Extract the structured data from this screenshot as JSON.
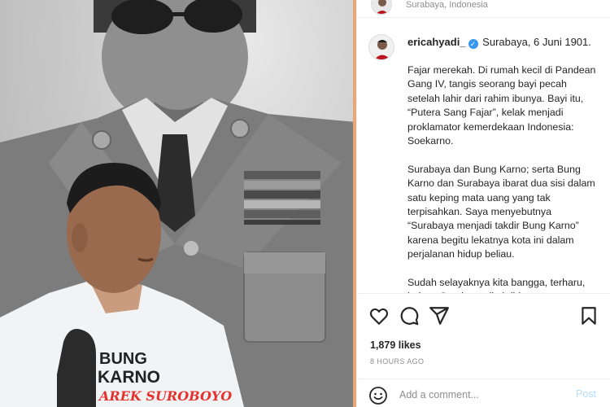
{
  "post": {
    "location": "Surabaya, Indonesia",
    "username": "ericahyadi_",
    "verified": true,
    "caption_first_line": "Surabaya, 6 Juni 1901.",
    "paragraphs": [
      "Fajar merekah. Di rumah kecil di Pandean Gang IV, tangis seorang bayi pecah setelah lahir dari rahim ibunya. Bayi itu, “Putera Sang Fajar”, kelak menjadi proklamator kemerdekaan Indonesia: Soekarno.",
      "Surabaya dan Bung Karno; serta Bung Karno dan Surabaya ibarat dua sisi dalam satu keping mata uang yang tak terpisahkan. Saya menyebutnya “Surabaya menjadi takdir Bung Karno” karena begitu lekatnya kota ini dalam perjalanan hidup beliau.",
      "Sudah selayaknya kita bangga, terharu, bahwa Surabaya ditakdirkan"
    ],
    "likes": "1,879 likes",
    "time_ago": "8 HOURS AGO"
  },
  "photo": {
    "shirt_text_line1": "BUNG",
    "shirt_text_line2": "KARNO",
    "shirt_text_line3": "AREK SUROBOYO"
  },
  "actions": {
    "like_icon": "heart-icon",
    "comment_icon": "comment-icon",
    "share_icon": "share-icon",
    "save_icon": "bookmark-icon"
  },
  "comment": {
    "placeholder": "Add a comment...",
    "post_label": "Post",
    "emoji_icon": "emoji-icon"
  },
  "colors": {
    "verified": "#3797f0",
    "post_button": "#b2dffc",
    "muted_text": "#8e8e8e",
    "shirt_accent": "#e5322d"
  }
}
